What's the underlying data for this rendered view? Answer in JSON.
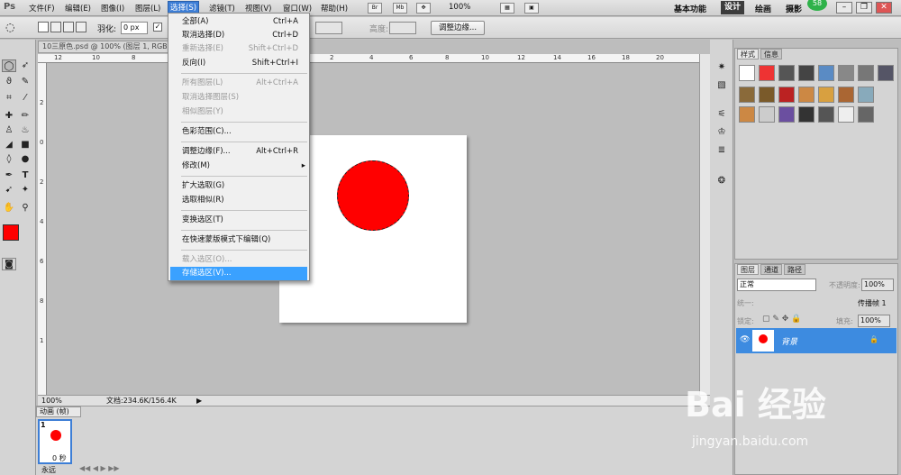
{
  "app": {
    "logo": "Ps"
  },
  "menubar": {
    "items": [
      "文件(F)",
      "编辑(E)",
      "图像(I)",
      "图层(L)",
      "选择(S)",
      "滤镜(T)",
      "视图(V)",
      "窗口(W)",
      "帮助(H)"
    ],
    "zoom": "100%",
    "workspaces": [
      "基本功能",
      "设计",
      "绘画",
      "摄影"
    ],
    "badge": "58"
  },
  "options": {
    "feather_label": "羽化:",
    "feather_value": "0 px",
    "height_label": "高度:",
    "refine_button": "调整边缘..."
  },
  "document": {
    "tab_title": "10三原色.psd @ 100% (图层 1, RGB",
    "zoom": "100%",
    "doc_info": "文档:234.6K/156.4K",
    "ruler_h": [
      "12",
      "10",
      "8",
      "6",
      "4",
      "2",
      "0",
      "2",
      "4",
      "6",
      "8",
      "10",
      "12",
      "14",
      "16",
      "18",
      "20",
      "22",
      "24",
      "26",
      "28"
    ],
    "ruler_v": [
      "2",
      "0",
      "2",
      "4",
      "6",
      "8",
      "1"
    ]
  },
  "select_menu": {
    "items": [
      {
        "label": "全部(A)",
        "shortcut": "Ctrl+A",
        "disabled": false
      },
      {
        "label": "取消选择(D)",
        "shortcut": "Ctrl+D",
        "disabled": false
      },
      {
        "label": "重新选择(E)",
        "shortcut": "Shift+Ctrl+D",
        "disabled": true
      },
      {
        "label": "反向(I)",
        "shortcut": "Shift+Ctrl+I",
        "disabled": false
      },
      {
        "label": "所有图层(L)",
        "shortcut": "Alt+Ctrl+A",
        "disabled": true
      },
      {
        "label": "取消选择图层(S)",
        "shortcut": "",
        "disabled": true
      },
      {
        "label": "相似图层(Y)",
        "shortcut": "",
        "disabled": true
      },
      {
        "label": "色彩范围(C)...",
        "shortcut": "",
        "disabled": false
      },
      {
        "label": "调整边缘(F)...",
        "shortcut": "Alt+Ctrl+R",
        "disabled": false
      },
      {
        "label": "修改(M)",
        "shortcut": "▸",
        "disabled": false
      },
      {
        "label": "扩大选取(G)",
        "shortcut": "",
        "disabled": false
      },
      {
        "label": "选取相似(R)",
        "shortcut": "",
        "disabled": false
      },
      {
        "label": "变换选区(T)",
        "shortcut": "",
        "disabled": false
      },
      {
        "label": "在快速蒙版模式下编辑(Q)",
        "shortcut": "",
        "disabled": false
      },
      {
        "label": "载入选区(O)...",
        "shortcut": "",
        "disabled": true
      },
      {
        "label": "存储选区(V)...",
        "shortcut": "",
        "disabled": false,
        "highlighted": true
      }
    ]
  },
  "styles_panel": {
    "tabs": [
      "样式",
      "信息"
    ]
  },
  "layers_panel": {
    "tabs": [
      "图层",
      "通道",
      "路径"
    ],
    "blend_mode": "正常",
    "opacity_label": "不透明度:",
    "opacity": "100%",
    "unify_label": "统一:",
    "propagate_label": "传播帧 1",
    "lock_label": "锁定:",
    "fill_label": "填充:",
    "fill": "100%",
    "layer_name": "背景"
  },
  "animation_panel": {
    "tab": "动画 (帧)",
    "frame_number": "1",
    "frame_time": "0 秒",
    "loop": "永远"
  },
  "colors": {
    "accent": "#3d8be0",
    "shape": "#ff0000",
    "foreground": "#ff0000",
    "background": "#ffffff"
  },
  "watermark": {
    "brand": "Bai 经验",
    "url": "jingyan.baidu.com"
  }
}
